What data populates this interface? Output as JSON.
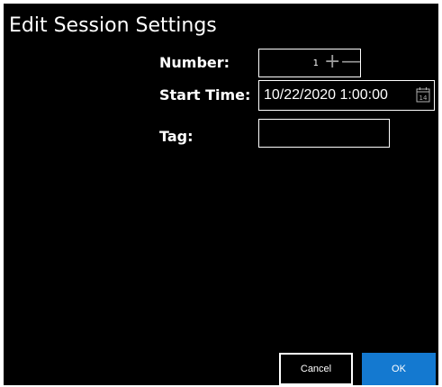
{
  "dialog": {
    "title": "Edit Session Settings"
  },
  "fields": {
    "number": {
      "label": "Number:",
      "value": "1",
      "increment_symbol": "+",
      "decrement_symbol": "—"
    },
    "start_time": {
      "label": "Start Time:",
      "value": "10/22/2020 1:00:00",
      "calendar_day": "14"
    },
    "tag": {
      "label": "Tag:",
      "value": ""
    }
  },
  "buttons": {
    "cancel_label": "Cancel",
    "ok_label": "OK"
  },
  "colors": {
    "dialog_background": "#000000",
    "text": "#ffffff",
    "accent": "#1479d0",
    "spin_glyph": "#9a9a9a"
  },
  "icons": {
    "increment": "plus-icon",
    "decrement": "minus-icon",
    "calendar": "calendar-icon"
  }
}
